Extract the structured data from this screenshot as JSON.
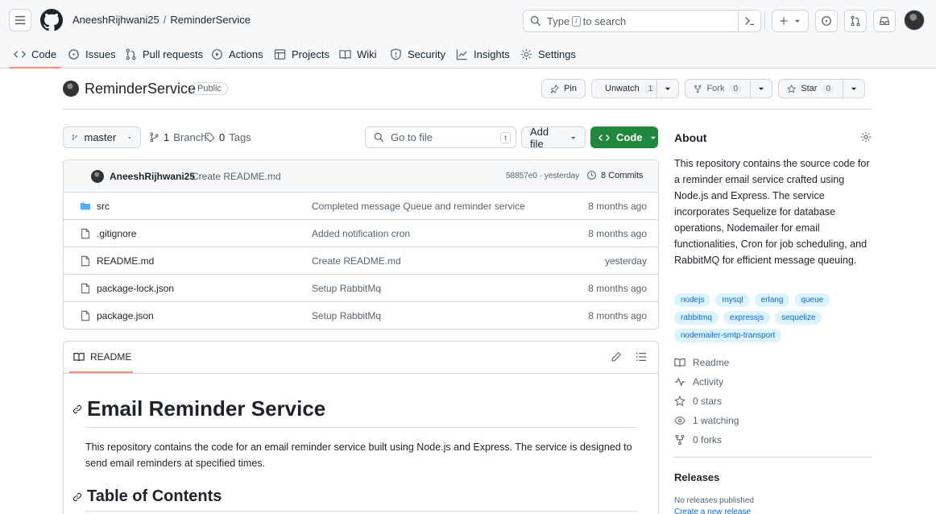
{
  "header": {
    "owner": "AneeshRijhwani25",
    "separator": "/",
    "repo": "ReminderService",
    "search_prefix": "Type",
    "search_key": "/",
    "search_suffix": "to search"
  },
  "tabs": [
    {
      "label": "Code",
      "icon": "code-icon"
    },
    {
      "label": "Issues",
      "icon": "issue-icon"
    },
    {
      "label": "Pull requests",
      "icon": "pull-request-icon"
    },
    {
      "label": "Actions",
      "icon": "play-icon"
    },
    {
      "label": "Projects",
      "icon": "table-icon"
    },
    {
      "label": "Wiki",
      "icon": "book-icon"
    },
    {
      "label": "Security",
      "icon": "shield-icon"
    },
    {
      "label": "Insights",
      "icon": "graph-icon"
    },
    {
      "label": "Settings",
      "icon": "gear-icon"
    }
  ],
  "repo_header": {
    "title": "ReminderService",
    "visibility": "Public",
    "pin_label": "Pin",
    "unwatch_label": "Unwatch",
    "watch_count": "1",
    "fork_label": "Fork",
    "fork_count": "0",
    "star_label": "Star",
    "star_count": "0"
  },
  "branch_bar": {
    "branch": "master",
    "branch_count": "1",
    "branch_word": "Branch",
    "tag_count": "0",
    "tag_word": "Tags",
    "goto_placeholder": "Go to file",
    "goto_key": "t",
    "add_file": "Add file",
    "code_label": "Code"
  },
  "latest_commit": {
    "author": "AneeshRijhwani25",
    "message": "Create README.md",
    "sha_time": "58857e0 · yesterday",
    "commits_label": "8 Commits"
  },
  "files": [
    {
      "name": "src",
      "type": "folder",
      "message": "Completed message Queue and reminder service",
      "age": "8 months ago"
    },
    {
      "name": ".gitignore",
      "type": "file",
      "message": "Added notification cron",
      "age": "8 months ago"
    },
    {
      "name": "README.md",
      "type": "file",
      "message": "Create README.md",
      "age": "yesterday"
    },
    {
      "name": "package-lock.json",
      "type": "file",
      "message": "Setup RabbitMq",
      "age": "8 months ago"
    },
    {
      "name": "package.json",
      "type": "file",
      "message": "Setup RabbitMq",
      "age": "8 months ago"
    }
  ],
  "readme": {
    "tab_label": "README",
    "h1": "Email Reminder Service",
    "paragraph": "This repository contains the code for an email reminder service built using Node.js and Express. The service is designed to send email reminders at specified times.",
    "h2": "Table of Contents"
  },
  "about": {
    "heading": "About",
    "description": "This repository contains the source code for a reminder email service crafted using Node.js and Express. The service incorporates Sequelize for database operations, Nodemailer for email functionalities, Cron for job scheduling, and RabbitMQ for efficient message queuing.",
    "topics": [
      "nodejs",
      "mysql",
      "erlang",
      "queue",
      "rabbitmq",
      "expressjs",
      "sequelize",
      "nodemailer-smtp-transport"
    ],
    "readme_link": "Readme",
    "activity_link": "Activity",
    "stars": "0 stars",
    "watching": "1 watching",
    "forks": "0 forks"
  },
  "releases": {
    "heading": "Releases",
    "none": "No releases published",
    "create": "Create a new release"
  },
  "colors": {
    "accent_tab": "#fd8c73",
    "code_button": "#1f883d",
    "topic_bg": "#ddf4ff",
    "topic_fg": "#0969da",
    "folder": "#54aeff"
  }
}
